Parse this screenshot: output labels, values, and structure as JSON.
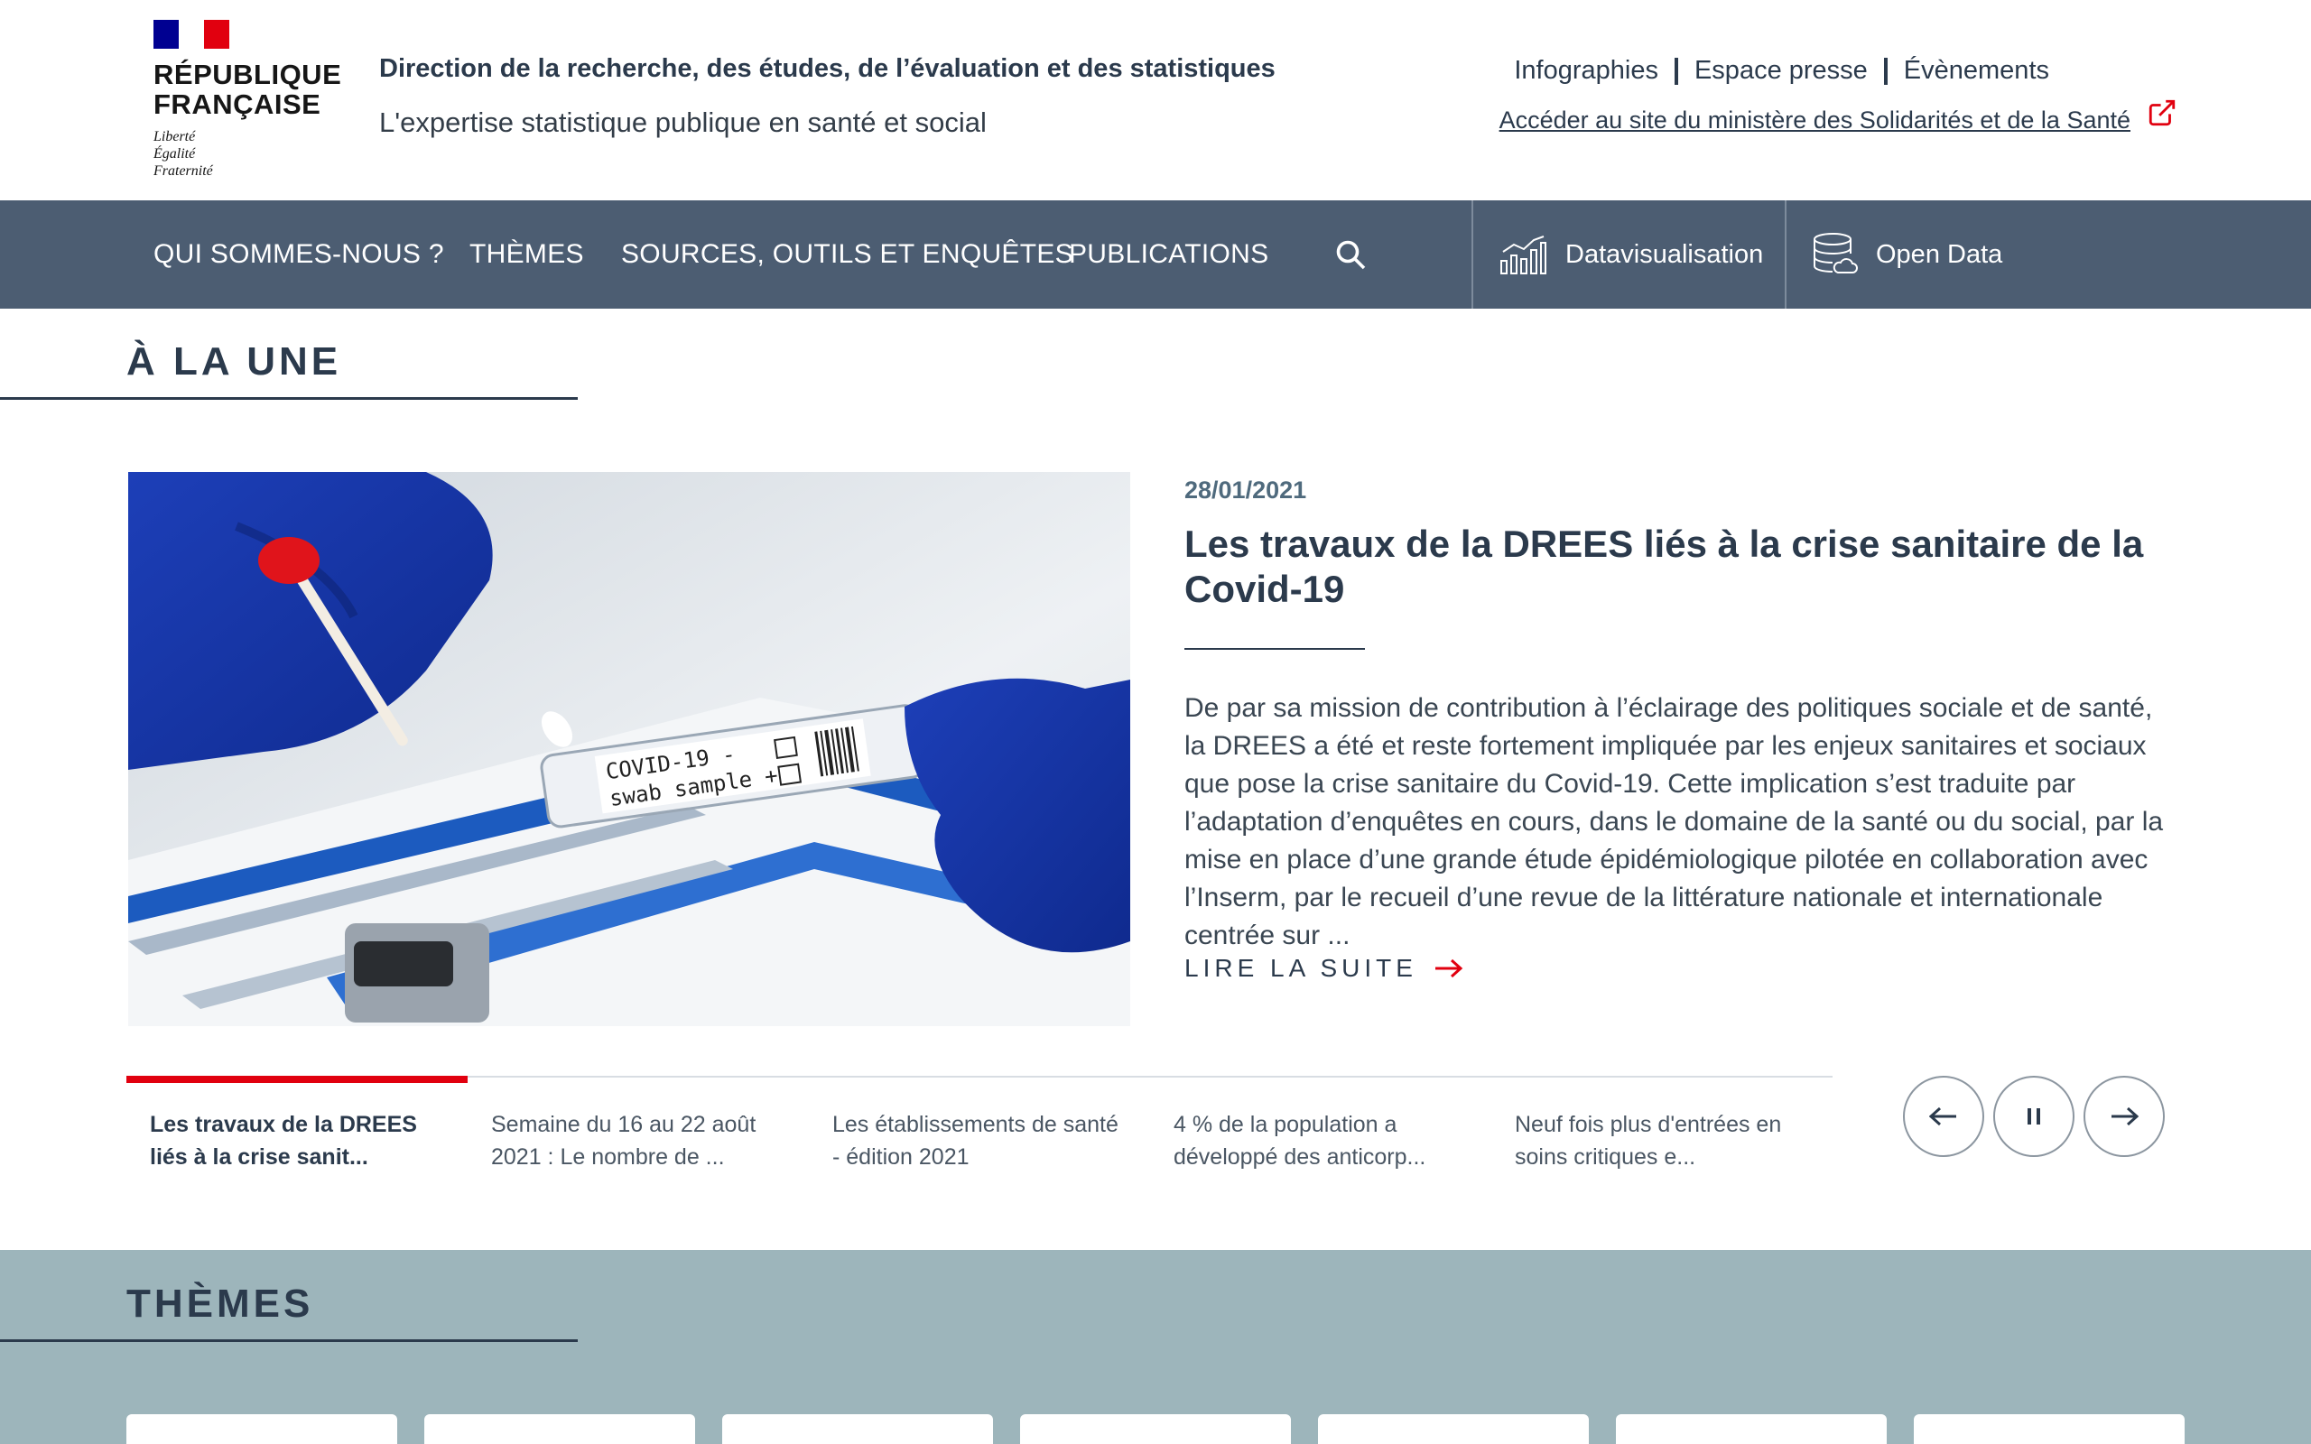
{
  "header": {
    "logo_text": "RÉPUBLIQUE\nFRANÇAISE",
    "logo_motto": "Liberté\nÉgalité\nFraternité",
    "title": "Direction de la recherche, des études, de l’évaluation et des statistiques",
    "subtitle": "L'expertise statistique publique en santé et social",
    "top_links": [
      "Infographies",
      "Espace presse",
      "Évènements"
    ],
    "ministry_link": "Accéder au site du ministère des Solidarités et de la Santé"
  },
  "nav": {
    "items": [
      "QUI SOMMES-NOUS ?",
      "THÈMES",
      "SOURCES, OUTILS ET ENQUÊTES",
      "PUBLICATIONS"
    ],
    "tools": [
      "Datavisualisation",
      "Open Data"
    ]
  },
  "headline": {
    "section_title": "À LA UNE",
    "image_text_1": "COVID-19 -",
    "image_text_2": "swab sample +",
    "date": "28/01/2021",
    "title": "Les travaux de la DREES liés à la crise sanitaire de la Covid-19",
    "body": "De par sa mission de contribution à l’éclairage des politiques sociale et de santé, la DREES a été et reste fortement impliquée par les enjeux sanitaires et sociaux que pose la crise sanitaire du Covid-19. Cette implication s’est traduite par l’adaptation d’enquêtes en cours, dans le domaine de la santé ou du social, par la mise en place d’une grande étude épidémiologique pilotée en collaboration avec l’Inserm, par le recueil d’une revue de la littérature nationale et internationale centrée sur ...",
    "read_more": "LIRE LA SUITE",
    "tabs": [
      "Les travaux de la DREES liés à la crise sanit...",
      "Semaine du 16 au 22 août 2021 : Le nombre de ...",
      "Les établissements de santé - édition 2021",
      "4 % de la population a développé des anticorp...",
      "Neuf fois plus d'entrées en soins critiques e..."
    ]
  },
  "themes": {
    "section_title": "THÈMES"
  },
  "colors": {
    "nav_bg": "#4c5d72",
    "accent_red": "#e1000f",
    "themes_bg": "#9db5bb",
    "text_dark": "#2b3a4c"
  },
  "icons": [
    "external-link-icon",
    "search-icon",
    "datavisualisation-icon",
    "open-data-icon",
    "arrow-right-icon",
    "arrow-left-icon",
    "pause-icon"
  ]
}
